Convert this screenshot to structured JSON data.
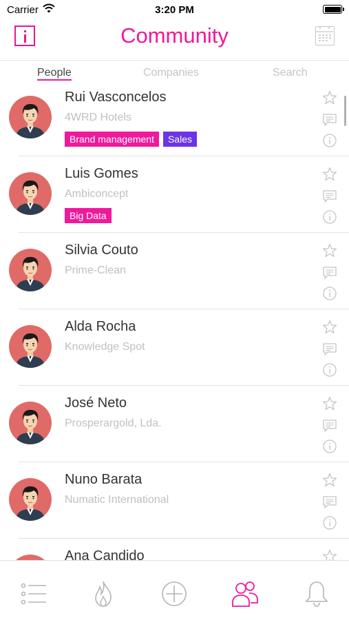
{
  "status_bar": {
    "carrier": "Carrier",
    "time": "3:20 PM"
  },
  "navbar": {
    "title": "Community",
    "left_icon": "info-square-icon",
    "right_icon": "calendar-icon"
  },
  "tabs": [
    {
      "label": "People",
      "active": true
    },
    {
      "label": "Companies",
      "active": false
    },
    {
      "label": "Search",
      "active": false
    }
  ],
  "people": [
    {
      "name": "Rui Vasconcelos",
      "company": "4WRD Hotels",
      "tags": [
        {
          "label": "Brand management",
          "color": "#f0189b"
        },
        {
          "label": "Sales",
          "color": "#6b34e8"
        }
      ]
    },
    {
      "name": "Luis Gomes",
      "company": "Ambiconcept",
      "tags": [
        {
          "label": "Big Data",
          "color": "#f0189b"
        }
      ]
    },
    {
      "name": "Silvia Couto",
      "company": "Prime-Clean",
      "tags": []
    },
    {
      "name": "Alda Rocha",
      "company": "Knowledge Spot",
      "tags": []
    },
    {
      "name": "José Neto",
      "company": "Prosperargold, Lda.",
      "tags": []
    },
    {
      "name": "Nuno Barata",
      "company": "Numatic International",
      "tags": []
    },
    {
      "name": "Ana Candido",
      "company": "",
      "tags": []
    }
  ],
  "tabbar": [
    {
      "icon": "list-icon",
      "active": false
    },
    {
      "icon": "flame-icon",
      "active": false
    },
    {
      "icon": "plus-circle-icon",
      "active": false
    },
    {
      "icon": "people-icon",
      "active": true
    },
    {
      "icon": "bell-icon",
      "active": false
    }
  ],
  "colors": {
    "accent": "#f0189b",
    "purple_tag": "#6b34e8",
    "muted": "#c0c0c0"
  }
}
